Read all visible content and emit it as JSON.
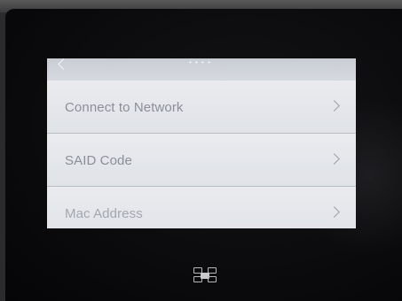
{
  "menu": {
    "items": [
      {
        "label": "Connect to Network"
      },
      {
        "label": "SAID Code"
      },
      {
        "label": "Mac Address"
      }
    ]
  },
  "icons": {
    "back": "chevron-left-icon",
    "item_arrow": "chevron-right-icon",
    "brand": "device-logo-icon"
  },
  "colors": {
    "screen_bg": "#e4e7eb",
    "label": "#8b8f99",
    "bezel": "#0b0b0d"
  }
}
